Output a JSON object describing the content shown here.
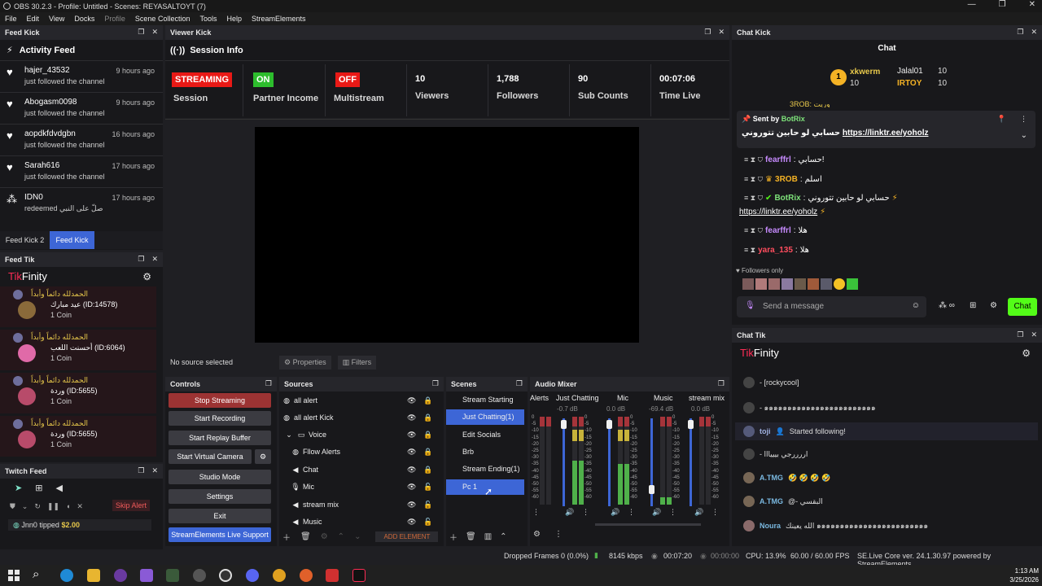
{
  "window": {
    "title": "OBS 30.2.3 - Profile: Untitled - Scenes: REYASALTOYT (7)"
  },
  "menu": [
    "File",
    "Edit",
    "View",
    "Docks",
    "Profile",
    "Scene Collection",
    "Tools",
    "Help",
    "StreamElements"
  ],
  "feed_kick": {
    "dock_title": "Feed Kick",
    "header": "Activity Feed",
    "items": [
      {
        "name": "hajer_43532",
        "sub": "just followed the channel",
        "time": "9 hours ago"
      },
      {
        "name": "Abogasm0098",
        "sub": "just followed the channel",
        "time": "9 hours ago"
      },
      {
        "name": "aopdkfdvdgbn",
        "sub": "just followed the channel",
        "time": "16 hours ago"
      },
      {
        "name": "Sarah616",
        "sub": "just followed the channel",
        "time": "17 hours ago"
      },
      {
        "name": "IDN0",
        "sub": "redeemed صلّ على النبي",
        "time": "17 hours ago"
      }
    ],
    "tabs": [
      "Feed Kick 2",
      "Feed Kick"
    ]
  },
  "feed_tik": {
    "dock_title": "Feed Tik",
    "brand_a": "Tik",
    "brand_b": "Finity",
    "items": [
      {
        "line1": "الحمدلله دائماً وأبداً",
        "line2": "عيد مبارك (ID:14578)",
        "line3": "1 Coin"
      },
      {
        "line1": "الحمدلله دائماً وأبداً",
        "line2": "أحسنت اللعب (ID:6064)",
        "line3": "1 Coin"
      },
      {
        "line1": "الحمدلله دائماً وأبداً",
        "line2": "وردة (ID:5655)",
        "line3": "1 Coin"
      },
      {
        "line1": "الحمدلله دائماً وأبداً",
        "line2": "وردة (ID:5655)",
        "line3": "1 Coin"
      }
    ]
  },
  "twitch_feed": {
    "dock_title": "Twitch Feed",
    "skip_alert": "Skip Alert",
    "tip_text": "Jnn0 tipped",
    "tip_amount": "$2.00"
  },
  "viewer_kick": {
    "dock_title": "Viewer Kick",
    "header": "Session Info",
    "stats": [
      {
        "value": "STREAMING",
        "label": "Session"
      },
      {
        "value": "ON",
        "label": "Partner Income"
      },
      {
        "value": "OFF",
        "label": "Multistream"
      },
      {
        "value": "10",
        "label": "Viewers"
      },
      {
        "value": "1,788",
        "label": "Followers"
      },
      {
        "value": "90",
        "label": "Sub Counts"
      },
      {
        "value": "00:07:06",
        "label": "Time Live"
      }
    ]
  },
  "preview_bar": {
    "status": "No source selected",
    "properties": "Properties",
    "filters": "Filters"
  },
  "controls": {
    "title": "Controls",
    "buttons": [
      "Stop Streaming",
      "Start Recording",
      "Start Replay Buffer",
      "Start Virtual Camera",
      "Studio Mode",
      "Settings",
      "Exit"
    ],
    "se_support": "StreamElements Live Support"
  },
  "sources": {
    "title": "Sources",
    "items": [
      "all alert",
      "all alert Kick",
      "Voice",
      "Fllow Alerts",
      "Chat",
      "Mic",
      "stream mix",
      "Music"
    ],
    "add_element": "ADD ELEMENT"
  },
  "scenes": {
    "title": "Scenes",
    "items": [
      "Stream Starting",
      "Just Chatting(1)",
      "Edit Socials",
      "Brb",
      "Stream Ending(1)",
      "Pc 1"
    ]
  },
  "audio_mixer": {
    "title": "Audio Mixer",
    "channels": [
      {
        "name": "Alerts",
        "db": "",
        "level": 0.0
      },
      {
        "name": "Just Chatting",
        "db": "-0.7 dB",
        "level": 0.75
      },
      {
        "name": "Mic",
        "db": "0.0 dB",
        "level": 0.55
      },
      {
        "name": "Music",
        "db": "-69.4 dB",
        "level": 0.1
      },
      {
        "name": "stream mix",
        "db": "0.0 dB",
        "level": 0.0
      }
    ],
    "scale": [
      "0",
      "-5",
      "-10",
      "-15",
      "-20",
      "-25",
      "-30",
      "-35",
      "-40",
      "-45",
      "-50",
      "-55",
      "-60"
    ]
  },
  "chat_kick": {
    "dock_title": "Chat Kick",
    "header": "Chat",
    "top": [
      {
        "rank": "1",
        "name": "xkwerm",
        "count": "10"
      },
      {
        "name": "Jalal01",
        "count": "10"
      },
      {
        "name": "IRTOY",
        "count": "10"
      }
    ],
    "pinned_sender_label": "Sent by",
    "pinned_sender": "BotRix",
    "pinned_text": "حسابي لو حابين تتوروني",
    "pinned_link": "https://linktr.ee/yoholz",
    "partial_line": "3ROB: وريت",
    "messages": [
      {
        "user": "fearffrl",
        "text": "حسابي!"
      },
      {
        "user": "3ROB",
        "text": "اسلم"
      },
      {
        "user": "BotRix",
        "text": "حسابي لو حابين تتوروني"
      },
      {
        "user": "",
        "text": "https://linktr.ee/yoholz"
      },
      {
        "user": "fearffrl",
        "text": "هلا"
      },
      {
        "user": "yara_135",
        "text": "هلا"
      }
    ],
    "followers_only": "Followers only",
    "input_placeholder": "Send a message",
    "chat_button": "Chat"
  },
  "chat_tik": {
    "dock_title": "Chat Tik",
    "brand_a": "Tik",
    "brand_b": "Finity",
    "rows": [
      {
        "user": "",
        "text": "- [rockycool]"
      },
      {
        "user": "",
        "text": "- ๑๑๑๑๑๑๑๑๑๑๑๑๑๑๑๑๑๑๑๑๑๑๑๑"
      },
      {
        "user": "toji",
        "text": "Started following!"
      },
      {
        "user": "",
        "text": "- اررررجي بيييااا"
      },
      {
        "user": "A.TMG",
        "text": "🤣 🤣 🤣 🤣"
      },
      {
        "user": "A.TMG",
        "text": "@- البقسي"
      },
      {
        "user": "Noura",
        "text": "الله يعينك ๑๑๑๑๑๑๑๑๑๑๑๑๑๑๑๑๑๑๑๑๑๑๑๑"
      }
    ]
  },
  "statusbar": {
    "dropped": "Dropped Frames 0 (0.0%)",
    "kbps": "8145 kbps",
    "live_time": "00:07:20",
    "rec_time": "00:00:00",
    "cpu": "CPU: 13.9%",
    "fps": "60.00 / 60.00 FPS",
    "se_core": "SE.Live Core ver. 24.1.30.97 powered by StreamElements"
  },
  "taskbar": {
    "time": "1:13 AM",
    "date": "3/25/2026"
  },
  "colors": {
    "accent_blue": "#3d66d6",
    "kick_green": "#53fc18",
    "streaming_red": "#e91916",
    "tikfinity_pink": "#fe2c55"
  }
}
